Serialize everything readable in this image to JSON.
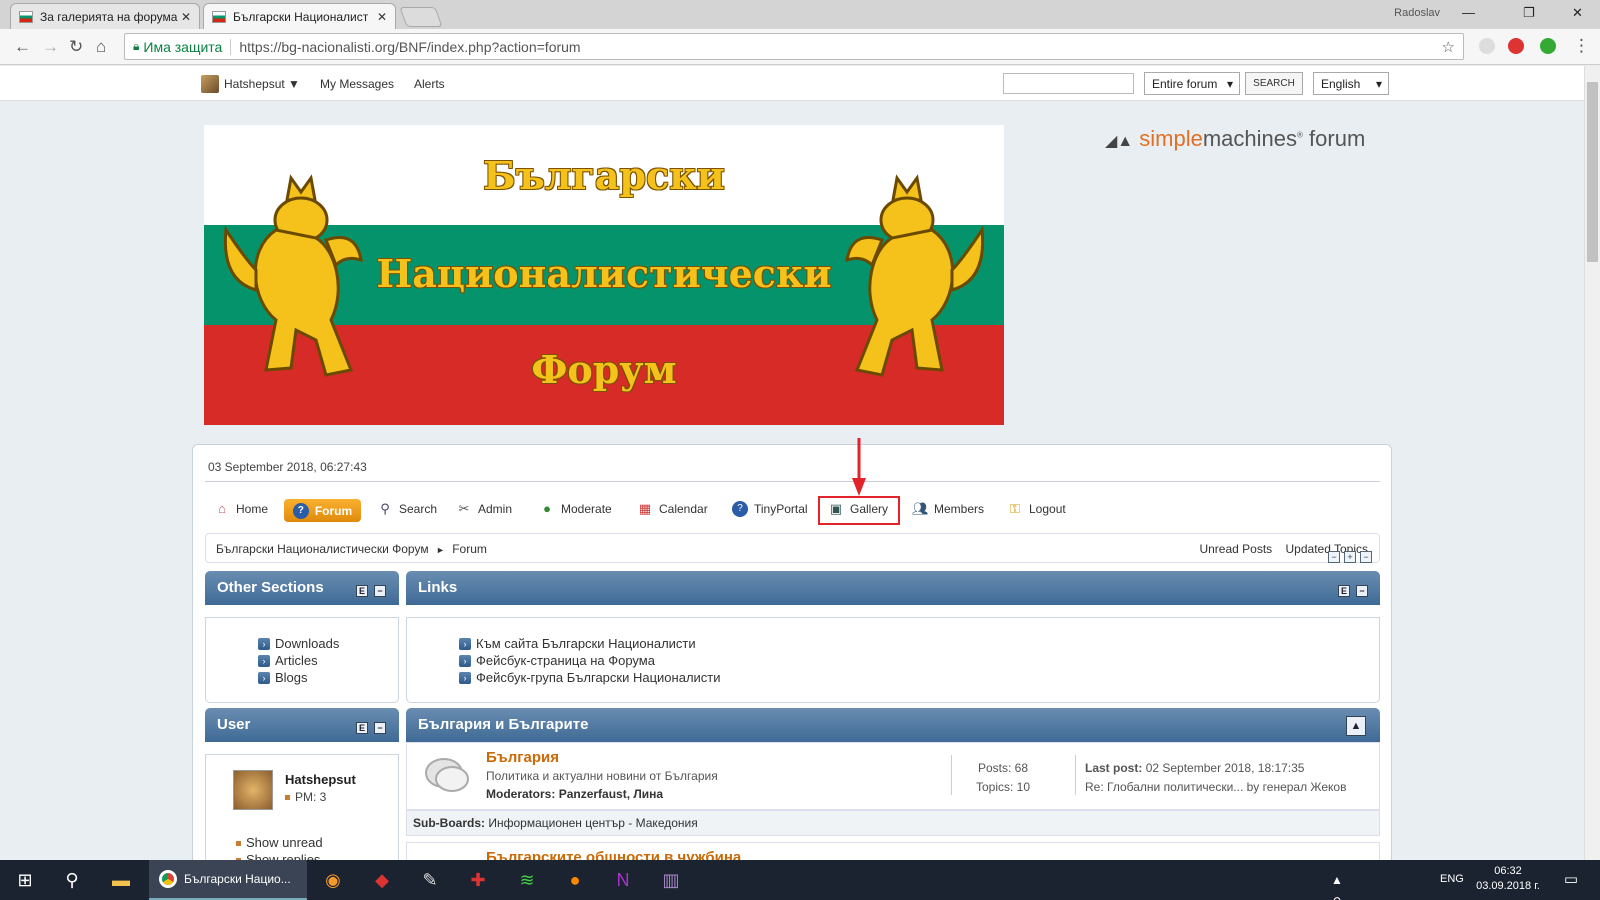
{
  "browser": {
    "tabs": [
      {
        "title": "За галерията на форума"
      },
      {
        "title": "Български Националист"
      }
    ],
    "profile_name": "Radoslav",
    "secure_label": "Има защита",
    "url": "https://bg-nacionalisti.org/BNF/index.php?action=forum"
  },
  "topbar": {
    "username": "Hatshepsut",
    "my_messages": "My Messages",
    "alerts": "Alerts",
    "search_scope": "Entire forum",
    "search_button": "SEARCH",
    "language": "English"
  },
  "banner": {
    "line1": "Български",
    "line2": "Националистически",
    "line3": "Форум",
    "smf_simple": "simple",
    "smf_rest": "machines",
    "smf_forum": "forum"
  },
  "datetime": "03 September 2018, 06:27:43",
  "menu": {
    "home": "Home",
    "forum": "Forum",
    "search": "Search",
    "admin": "Admin",
    "moderate": "Moderate",
    "calendar": "Calendar",
    "tinyportal": "TinyPortal",
    "gallery": "Gallery",
    "members": "Members",
    "logout": "Logout"
  },
  "breadcrumb": {
    "home": "Български Националистически Форум",
    "sep": "►",
    "current": "Forum",
    "unread": "Unread Posts",
    "updated": "Updated Topics"
  },
  "panels": {
    "other_sections": {
      "title": "Other Sections",
      "items": [
        "Downloads",
        "Articles",
        "Blogs"
      ]
    },
    "links": {
      "title": "Links",
      "items": [
        "Към сайта Български Националисти",
        "Фейсбук-страница на Форума",
        "Фейсбук-група Български Националисти"
      ]
    },
    "user": {
      "title": "User",
      "name": "Hatshepsut",
      "pm": "PM: 3",
      "show_unread": "Show unread",
      "show_replies": "Show replies"
    }
  },
  "category": {
    "title": "България и Българите",
    "board": {
      "title": "България",
      "description": "Политика и актуални новини от България",
      "moderators_label": "Moderators:",
      "moderators": "Panzerfaust, Лина",
      "posts": "Posts: 68",
      "topics": "Topics: 10",
      "last_post_label": "Last post:",
      "last_post_date": "02 September 2018, 18:17:35",
      "last_post_topic": "Re: Глобални политически...",
      "by": "by",
      "last_post_author": "генерал Жеков",
      "subboards_label": "Sub-Boards:",
      "subboards": "Информационен център - Македония"
    },
    "board2_title": "Българските общности в чужбина"
  },
  "taskbar": {
    "active_window": "Български Нацио...",
    "lang": "ENG",
    "time": "06:32",
    "date": "03.09.2018 г."
  }
}
